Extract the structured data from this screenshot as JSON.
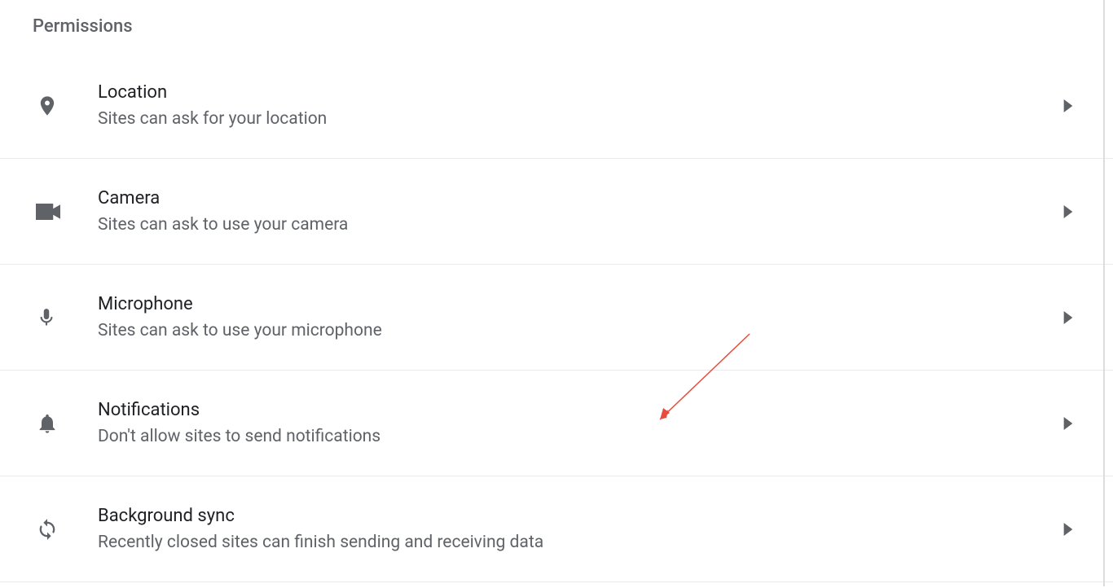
{
  "section": {
    "title": "Permissions"
  },
  "permissions": [
    {
      "icon": "location",
      "title": "Location",
      "desc": "Sites can ask for your location"
    },
    {
      "icon": "camera",
      "title": "Camera",
      "desc": "Sites can ask to use your camera"
    },
    {
      "icon": "microphone",
      "title": "Microphone",
      "desc": "Sites can ask to use your microphone"
    },
    {
      "icon": "notifications",
      "title": "Notifications",
      "desc": "Don't allow sites to send notifications"
    },
    {
      "icon": "sync",
      "title": "Background sync",
      "desc": "Recently closed sites can finish sending and receiving data"
    }
  ]
}
